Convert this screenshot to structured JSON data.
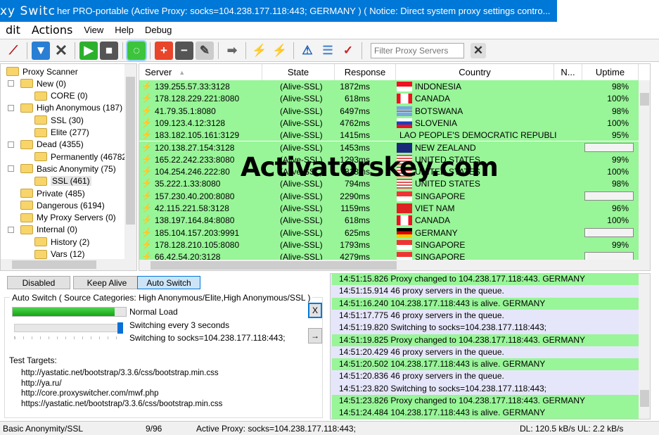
{
  "window": {
    "title_app": "xy Switc",
    "title": "her PRO-portable (Active Proxy: socks=104.238.177.118:443; GERMANY ) ( Notice: Direct system proxy settings contro..."
  },
  "menu": [
    "dit",
    "Actions",
    "View",
    "Help",
    "Debug"
  ],
  "toolbar": {
    "icons": [
      "wizard-icon",
      "download-icon",
      "delete-icon",
      "play-icon",
      "stop-icon",
      "auto-switch-icon",
      "add-icon",
      "remove-icon",
      "edit-icon",
      "export-icon",
      "disconnect-icon",
      "connect-icon",
      "warning-icon",
      "list-icon",
      "check-document-icon"
    ],
    "filter_placeholder": "Filter Proxy Servers"
  },
  "tree": [
    {
      "label": "Proxy Scanner",
      "level": 0
    },
    {
      "label": "New (0)",
      "level": 1,
      "expander": "-"
    },
    {
      "label": "CORE (0)",
      "level": 2
    },
    {
      "label": "High Anonymous (187)",
      "level": 1,
      "expander": "-"
    },
    {
      "label": "SSL (30)",
      "level": 2
    },
    {
      "label": "Elite (277)",
      "level": 2
    },
    {
      "label": "Dead (4355)",
      "level": 1,
      "expander": "-"
    },
    {
      "label": "Permanently (46782",
      "level": 2
    },
    {
      "label": "Basic Anonymity (75)",
      "level": 1,
      "expander": "-"
    },
    {
      "label": "SSL (461)",
      "level": 2,
      "selected": true
    },
    {
      "label": "Private (485)",
      "level": 1
    },
    {
      "label": "Dangerous (6194)",
      "level": 1
    },
    {
      "label": "My Proxy Servers (0)",
      "level": 1
    },
    {
      "label": "Internal (0)",
      "level": 1,
      "expander": "-"
    },
    {
      "label": "History (2)",
      "level": 2
    },
    {
      "label": "Vars (12)",
      "level": 2
    }
  ],
  "grid": {
    "columns": [
      "Server",
      "State",
      "Response",
      "Country",
      "N...",
      "Uptime"
    ],
    "sort_indicator": "▲",
    "rows": [
      {
        "server": "139.255.57.33:3128",
        "state": "(Alive-SSL)",
        "response": "1872ms",
        "country": "INDONESIA",
        "flag": "id",
        "uptime": "98%"
      },
      {
        "server": "178.128.229.221:8080",
        "state": "(Alive-SSL)",
        "response": "618ms",
        "country": "CANADA",
        "flag": "ca",
        "uptime": "100%"
      },
      {
        "server": "41.79.35.1:8080",
        "state": "(Alive-SSL)",
        "response": "6497ms",
        "country": "BOTSWANA",
        "flag": "bw",
        "uptime": "98%"
      },
      {
        "server": "109.123.4.12:3128",
        "state": "(Alive-SSL)",
        "response": "4762ms",
        "country": "SLOVENIA",
        "flag": "si",
        "uptime": "100%"
      },
      {
        "server": "183.182.105.161:3129",
        "state": "(Alive-SSL)",
        "response": "1415ms",
        "country": "LAO PEOPLE'S DEMOCRATIC REPUBLI",
        "flag": "",
        "uptime": "95%"
      },
      {
        "server": "120.138.27.154:3128",
        "state": "(Alive-SSL)",
        "response": "1453ms",
        "country": "NEW ZEALAND",
        "flag": "nz",
        "uptime_bar": 0
      },
      {
        "server": "165.22.242.233:8080",
        "state": "(Alive-SSL)",
        "response": "1293ms",
        "country": "UNITED STATES",
        "flag": "us",
        "uptime": "99%"
      },
      {
        "server": "104.254.246.222:80",
        "state": "(Alive-SSL)",
        "response": "813ms",
        "country": "UNITED STATES",
        "flag": "us",
        "uptime": "100%"
      },
      {
        "server": "35.222.1.33:8080",
        "state": "(Alive-SSL)",
        "response": "794ms",
        "country": "UNITED STATES",
        "flag": "us",
        "uptime": "98%"
      },
      {
        "server": "157.230.40.200:8080",
        "state": "(Alive-SSL)",
        "response": "2290ms",
        "country": "SINGAPORE",
        "flag": "sg",
        "uptime_bar": 0
      },
      {
        "server": "42.115.221.58:3128",
        "state": "(Alive-SSL)",
        "response": "1159ms",
        "country": "VIET NAM",
        "flag": "vn",
        "uptime": "96%"
      },
      {
        "server": "138.197.164.84:8080",
        "state": "(Alive-SSL)",
        "response": "618ms",
        "country": "CANADA",
        "flag": "ca",
        "uptime": "100%"
      },
      {
        "server": "185.104.157.203:9991",
        "state": "(Alive-SSL)",
        "response": "625ms",
        "country": "GERMANY",
        "flag": "de",
        "uptime_bar": 5
      },
      {
        "server": "178.128.210.105:8080",
        "state": "(Alive-SSL)",
        "response": "1793ms",
        "country": "SINGAPORE",
        "flag": "sg",
        "uptime": "99%"
      },
      {
        "server": "66.42.54.20:3128",
        "state": "(Alive-SSL)",
        "response": "4279ms",
        "country": "SINGAPORE",
        "flag": "sg",
        "uptime_bar": 5
      }
    ]
  },
  "watermark": "Activatorskey.com",
  "modes": {
    "buttons": [
      "Disabled",
      "Keep Alive",
      "Auto Switch"
    ],
    "active": "Auto Switch"
  },
  "autoswitch": {
    "group_title": "Auto Switch ( Source Categories: High Anonymous/Elite,High Anonymous/SSL )",
    "load_label": "Normal Load",
    "load_percent": 90,
    "interval_label": "Switching every 3 seconds",
    "slider_percent": 100,
    "switching_label": "Switching to socks=104.238.177.118:443;",
    "close_button": "X",
    "next_button": "→"
  },
  "test_targets": {
    "title": "Test Targets:",
    "urls": [
      "http://yastatic.net/bootstrap/3.3.6/css/bootstrap.min.css",
      "http://ya.ru/",
      "http://core.proxyswitcher.com/mwf.php",
      "https://yastatic.net/bootstrap/3.3.6/css/bootstrap.min.css"
    ]
  },
  "log": [
    {
      "text": "14:51:15.826 Proxy changed to 104.238.177.118:443. GERMANY",
      "hl": true
    },
    {
      "text": "14:51:15.914 46 proxy servers in the queue.",
      "hl": false
    },
    {
      "text": "14:51:16.240 104.238.177.118:443 is alive. GERMANY",
      "hl": true
    },
    {
      "text": "14:51:17.775 46 proxy servers in the queue.",
      "hl": false
    },
    {
      "text": "14:51:19.820 Switching to socks=104.238.177.118:443;",
      "hl": false
    },
    {
      "text": "14:51:19.825 Proxy changed to 104.238.177.118:443. GERMANY",
      "hl": true
    },
    {
      "text": "14:51:20.429 46 proxy servers in the queue.",
      "hl": false
    },
    {
      "text": "14:51:20.502 104.238.177.118:443 is alive. GERMANY",
      "hl": true
    },
    {
      "text": "14:51:20.836 46 proxy servers in the queue.",
      "hl": false
    },
    {
      "text": "14:51:23.820 Switching to socks=104.238.177.118:443;",
      "hl": false
    },
    {
      "text": "14:51:23.826 Proxy changed to 104.238.177.118:443. GERMANY",
      "hl": true
    },
    {
      "text": "14:51:24.484 104.238.177.118:443 is alive. GERMANY",
      "hl": true
    }
  ],
  "status": {
    "category": "Basic Anonymity/SSL",
    "count": "9/96",
    "active": "Active Proxy: socks=104.238.177.118:443;",
    "speed": "DL: 120.5 kB/s UL: 2.2 kB/s"
  },
  "colors": {
    "title_bar": "#0078d7",
    "alive_row": "#98f598",
    "log_bg": "#e6e6fa",
    "load_bar": "#1db31d"
  }
}
